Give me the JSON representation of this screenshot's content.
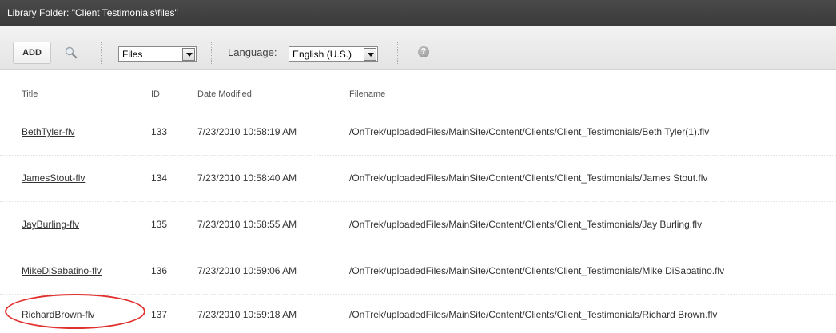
{
  "window": {
    "title": "Library Folder: \"Client Testimonials\\files\""
  },
  "toolbar": {
    "add_label": "ADD",
    "type_select": "Files",
    "language_label": "Language:",
    "language_select": "English (U.S.)",
    "help_glyph": "?"
  },
  "columns": {
    "title": "Title",
    "id": "ID",
    "date": "Date Modified",
    "filename": "Filename"
  },
  "rows": [
    {
      "title": "BethTyler-flv",
      "id": "133",
      "date": "7/23/2010 10:58:19 AM",
      "filename": "/OnTrek/uploadedFiles/MainSite/Content/Clients/Client_Testimonials/Beth Tyler(1).flv"
    },
    {
      "title": "JamesStout-flv",
      "id": "134",
      "date": "7/23/2010 10:58:40 AM",
      "filename": "/OnTrek/uploadedFiles/MainSite/Content/Clients/Client_Testimonials/James Stout.flv"
    },
    {
      "title": "JayBurling-flv",
      "id": "135",
      "date": "7/23/2010 10:58:55 AM",
      "filename": "/OnTrek/uploadedFiles/MainSite/Content/Clients/Client_Testimonials/Jay Burling.flv"
    },
    {
      "title": "MikeDiSabatino-flv",
      "id": "136",
      "date": "7/23/2010 10:59:06 AM",
      "filename": "/OnTrek/uploadedFiles/MainSite/Content/Clients/Client_Testimonials/Mike DiSabatino.flv"
    },
    {
      "title": "RichardBrown-flv",
      "id": "137",
      "date": "7/23/2010 10:59:18 AM",
      "filename": "/OnTrek/uploadedFiles/MainSite/Content/Clients/Client_Testimonials/Richard Brown.flv"
    }
  ],
  "colors": {
    "titlebar": "#3f3f3f",
    "highlight": "#e0312f"
  },
  "icons": [
    "search-icon",
    "dropdown-arrow-icon",
    "help-icon"
  ]
}
